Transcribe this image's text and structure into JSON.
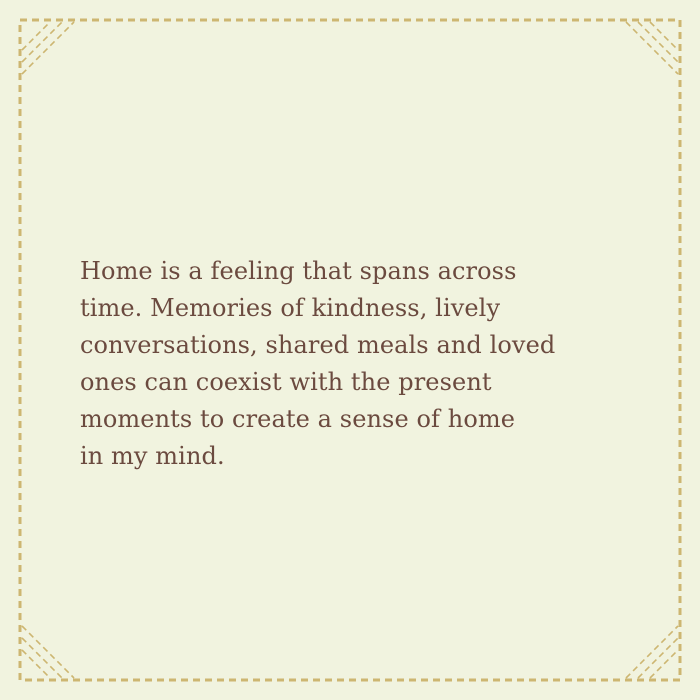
{
  "card": {
    "quote": "Home is a feeling that spans across\ntime.  Memories of kindness, lively\nconversations, shared meals and loved\nones can coexist with the present\nmoments to create a sense of home\nin my mind."
  },
  "colors": {
    "background": "#f1f3df",
    "border": "#cdb671",
    "text": "#6b4a3f"
  },
  "decor": {
    "border_style": "dashed",
    "corner_ornament": "diagonal-dashed-lines"
  }
}
